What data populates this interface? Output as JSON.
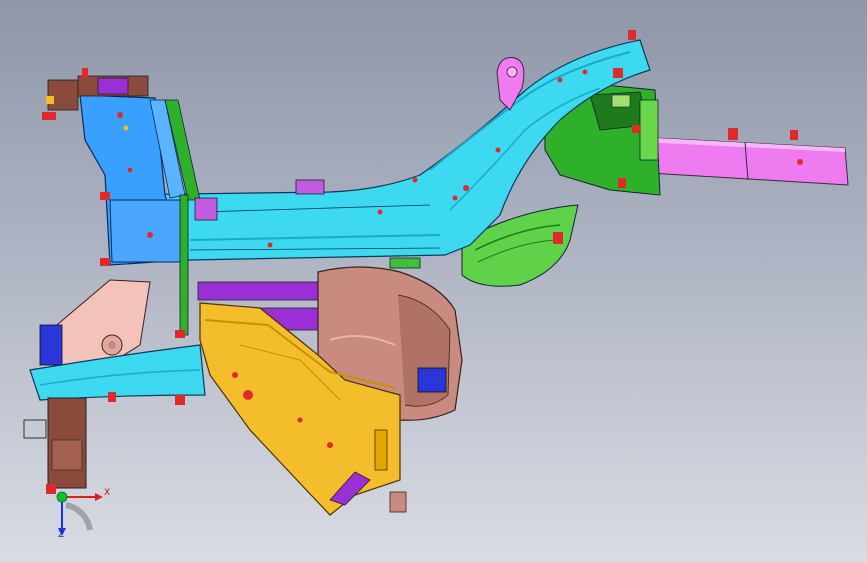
{
  "viewport": {
    "background_top": "#8e96a8",
    "background_bottom": "#d9dce3"
  },
  "model": {
    "colors": {
      "cyan": "#3cd9f0",
      "cyan_dark": "#1fa8c8",
      "blue": "#3aa0ff",
      "magenta": "#ee7cf0",
      "green": "#2fb02a",
      "green_light": "#5fd24a",
      "yellow": "#f3bd2b",
      "salmon": "#c98a80",
      "pink_light": "#f2c2bb",
      "purple": "#9a2fd6",
      "red_fastener": "#e02a2a",
      "brown": "#8a4b3c",
      "navy": "#2a36d8"
    }
  },
  "triad": {
    "x_label": "X",
    "z_label": "Z",
    "x_color": "#e02020",
    "z_color": "#2030e0",
    "origin_color": "#10c020"
  }
}
